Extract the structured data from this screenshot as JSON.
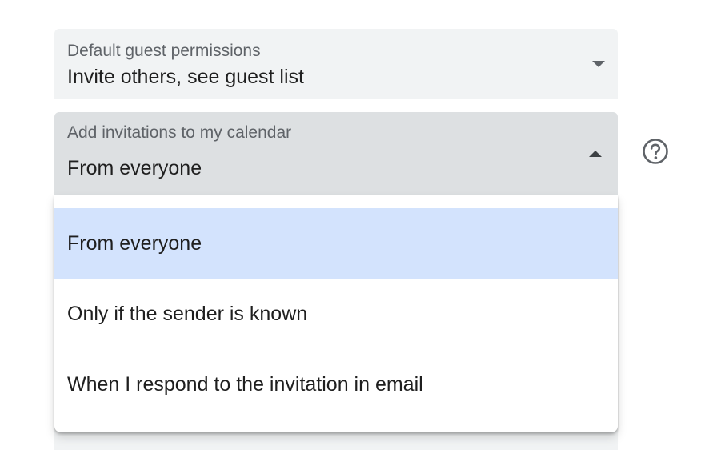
{
  "fields": {
    "default_guest_permissions": {
      "label": "Default guest permissions",
      "value": "Invite others, see guest list"
    },
    "add_invitations": {
      "label": "Add invitations to my calendar",
      "value": "From everyone",
      "open": true
    }
  },
  "dropdown": {
    "options": [
      {
        "label": "From everyone",
        "selected": true
      },
      {
        "label": "Only if the sender is known",
        "selected": false
      },
      {
        "label": "When I respond to the invitation in email",
        "selected": false
      }
    ]
  },
  "icons": {
    "help": "help-circle-icon",
    "dropdown_closed": "caret-down-icon",
    "dropdown_open": "caret-up-icon"
  },
  "colors": {
    "field_bg": "#f1f3f4",
    "field_active_bg": "#dde0e2",
    "selected_option_bg": "#d3e3fd"
  }
}
